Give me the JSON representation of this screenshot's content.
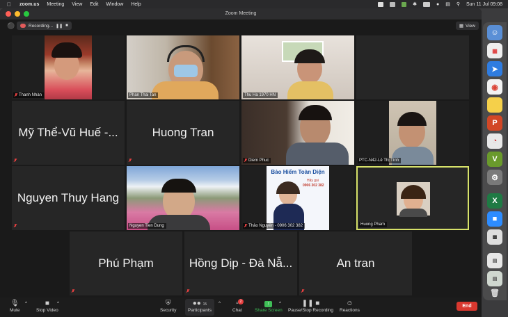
{
  "menubar": {
    "app_name": "zoom.us",
    "items": [
      "Meeting",
      "View",
      "Edit",
      "Window",
      "Help"
    ],
    "clock": "Sun 11 Jul  09:08"
  },
  "window": {
    "title": "Zoom Meeting"
  },
  "topbar": {
    "recording_label": "Recording...",
    "view_label": "View"
  },
  "participants": [
    {
      "name": "Thanh Nhàn",
      "video": true,
      "muted": true
    },
    {
      "name": "Phan Thai Tan",
      "video": true,
      "muted": false
    },
    {
      "name": "Thu Ha 1970 HN",
      "video": true,
      "muted": false
    },
    {
      "name": "",
      "video": false,
      "muted": false
    },
    {
      "name": "Mỹ Thể-Vũ Huế -...",
      "video": false,
      "muted": true
    },
    {
      "name": "Huong Tran",
      "video": false,
      "muted": true
    },
    {
      "name": "Diem Phuc",
      "video": true,
      "muted": true
    },
    {
      "name": "PTC-N42-Lê Thị Tính",
      "video": true,
      "muted": false
    },
    {
      "name": "Nguyen Thuy Hang",
      "video": false,
      "muted": true
    },
    {
      "name": "Nguyen Tien Dung",
      "video": true,
      "muted": false
    },
    {
      "name": "Thảo Nguyễn - 0906 302 382",
      "video": true,
      "muted": true
    },
    {
      "name": "Huong Pham",
      "video": true,
      "muted": false,
      "active_speaker": true
    },
    {
      "name": "Phú Phạm",
      "video": false,
      "muted": true
    },
    {
      "name": "Hồng Dịp - Đà Nẵ...",
      "video": false,
      "muted": true
    },
    {
      "name": "An tran",
      "video": false,
      "muted": true
    }
  ],
  "banner": {
    "title": "Bảo Hiểm Toàn Diện",
    "subtitle": "Hãy gọi",
    "phone": "0906 302 382"
  },
  "toolbar": {
    "mute": "Mute",
    "stop_video": "Stop Video",
    "security": "Security",
    "participants": "Participants",
    "participants_count": "15",
    "chat": "Chat",
    "chat_badge": "2",
    "share_screen": "Share Screen",
    "pause_stop_recording": "Pause/Stop Recording",
    "reactions": "Reactions",
    "end": "End"
  },
  "colors": {
    "accent_green": "#3fbf57",
    "end_red": "#d9382f",
    "speaker_border": "#d7e26a"
  }
}
